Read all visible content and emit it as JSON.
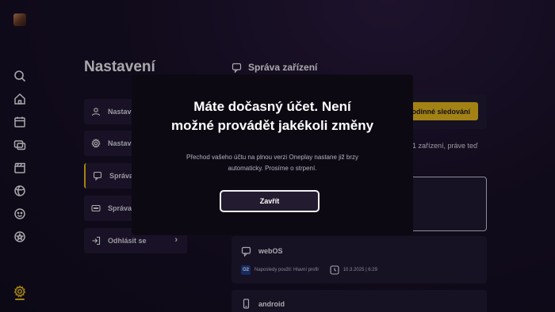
{
  "sidebar": {
    "icons": [
      "avatar",
      "search-icon",
      "home-icon",
      "calendar-icon",
      "multiscreen-icon",
      "clapperboard-icon",
      "sports-icon",
      "kids-icon",
      "favorites-icon",
      "settings-icon"
    ]
  },
  "settings": {
    "title": "Nastavení",
    "menu": [
      {
        "label": "Nastav",
        "icon": "user-icon"
      },
      {
        "label": "Nastav",
        "icon": "gear-icon"
      },
      {
        "label": "Správa",
        "icon": "chat-icon",
        "active": true
      },
      {
        "label": "Správa",
        "icon": "dots-icon"
      },
      {
        "label": "Odhlásit se",
        "icon": "logout-icon"
      }
    ]
  },
  "content": {
    "section_title": "Správa zařízení",
    "family_button": "odinné sledování",
    "devices_info": "1 zařízení, práve teď",
    "devices": [
      {
        "name": "webOS",
        "icon": "tv-icon",
        "logo": "O2",
        "last_used": "Naposledy použil: Hlavní profil",
        "datetime": "10.3.2025 | 6:29"
      },
      {
        "name": "android",
        "icon": "phone-icon"
      }
    ]
  },
  "modal": {
    "title_line1": "Máte dočasný účet. Není",
    "title_line2": "možné provádět jakékoli změny",
    "text_line1": "Přechod vašeho účtu na plnou verzi Oneplay nastane již brzy",
    "text_line2": "automaticky. Prosíme o strpení.",
    "close_label": "Zavřít"
  },
  "colors": {
    "accent": "#f5c518",
    "background": "#160f24",
    "card": "#1f1830",
    "modal": "#0c0913"
  }
}
